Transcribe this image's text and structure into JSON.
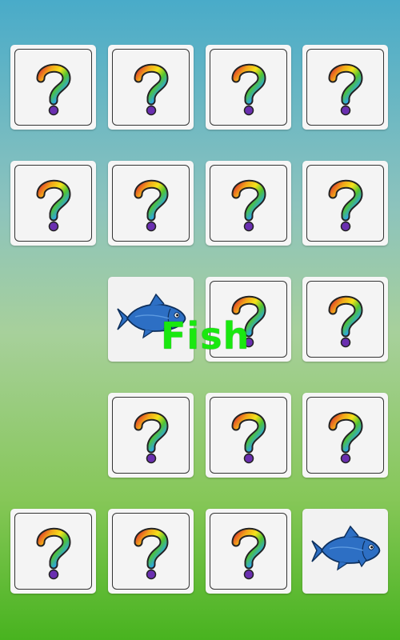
{
  "game": {
    "cards": [
      {
        "row": 1,
        "col": 1,
        "state": "hidden",
        "icon": "question-mark-icon"
      },
      {
        "row": 1,
        "col": 2,
        "state": "hidden",
        "icon": "question-mark-icon"
      },
      {
        "row": 1,
        "col": 3,
        "state": "hidden",
        "icon": "question-mark-icon"
      },
      {
        "row": 1,
        "col": 4,
        "state": "hidden",
        "icon": "question-mark-icon"
      },
      {
        "row": 2,
        "col": 1,
        "state": "hidden",
        "icon": "question-mark-icon"
      },
      {
        "row": 2,
        "col": 2,
        "state": "hidden",
        "icon": "question-mark-icon"
      },
      {
        "row": 2,
        "col": 3,
        "state": "hidden",
        "icon": "question-mark-icon"
      },
      {
        "row": 2,
        "col": 4,
        "state": "hidden",
        "icon": "question-mark-icon"
      },
      {
        "row": 3,
        "col": 1,
        "state": "matched",
        "icon": "none"
      },
      {
        "row": 3,
        "col": 2,
        "state": "revealed",
        "icon": "fish-icon"
      },
      {
        "row": 3,
        "col": 3,
        "state": "hidden",
        "icon": "question-mark-icon"
      },
      {
        "row": 3,
        "col": 4,
        "state": "hidden",
        "icon": "question-mark-icon"
      },
      {
        "row": 4,
        "col": 1,
        "state": "matched",
        "icon": "none"
      },
      {
        "row": 4,
        "col": 2,
        "state": "hidden",
        "icon": "question-mark-icon"
      },
      {
        "row": 4,
        "col": 3,
        "state": "hidden",
        "icon": "question-mark-icon"
      },
      {
        "row": 4,
        "col": 4,
        "state": "hidden",
        "icon": "question-mark-icon"
      },
      {
        "row": 5,
        "col": 1,
        "state": "hidden",
        "icon": "question-mark-icon"
      },
      {
        "row": 5,
        "col": 2,
        "state": "hidden",
        "icon": "question-mark-icon"
      },
      {
        "row": 5,
        "col": 3,
        "state": "hidden",
        "icon": "question-mark-icon"
      },
      {
        "row": 5,
        "col": 4,
        "state": "revealed",
        "icon": "fish-icon"
      }
    ],
    "revealed_word": "Fish",
    "colors": {
      "word": "#19e80f",
      "fish_body": "#2d6fc4",
      "question_gradient": [
        "#e03a2a",
        "#f2a51a",
        "#f4e31b",
        "#4fc233",
        "#2ea7e0",
        "#7a3fb5"
      ]
    }
  }
}
